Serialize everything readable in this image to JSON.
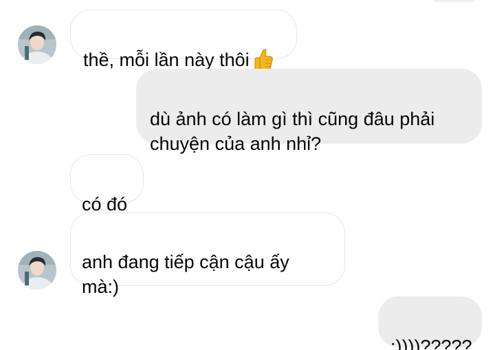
{
  "conversation": {
    "messages": [
      {
        "side": "incoming",
        "text": "thề, mỗi lần này thôi",
        "emoji": "thumbs-up-icon"
      },
      {
        "side": "outgoing",
        "text": "dù ảnh có làm gì thì cũng đâu phải\nchuyện của anh nhỉ?"
      },
      {
        "side": "incoming",
        "text": "có đó"
      },
      {
        "side": "incoming",
        "text": "anh đang tiếp cận cậu ấy\nmà:)"
      },
      {
        "side": "outgoing",
        "text": ":))))?????"
      }
    ]
  },
  "colors": {
    "incoming_bubble": "#ffffff",
    "incoming_border": "#e6e6e6",
    "outgoing_bubble": "#ececec",
    "text": "#050505"
  }
}
